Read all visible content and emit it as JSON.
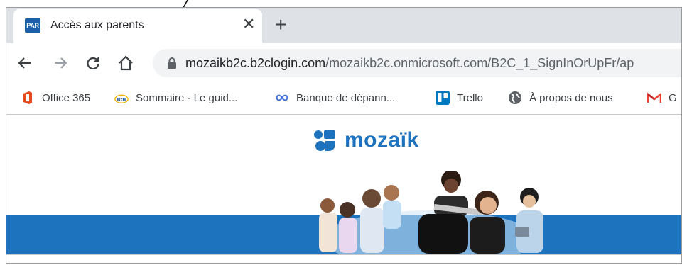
{
  "tab": {
    "favicon_text": "PAR",
    "title": "Accès aux parents",
    "close_symbol": "✕",
    "new_tab_symbol": "+"
  },
  "toolbar": {
    "url_domain": "mozaikb2c.b2clogin.com",
    "url_path": "/mozaikb2c.onmicrosoft.com/B2C_1_SignInOrUpFr/ap"
  },
  "bookmarks": [
    {
      "label": "Office 365",
      "icon": "office-icon"
    },
    {
      "label": "Sommaire - Le guid...",
      "icon": "btb-icon"
    },
    {
      "label": "Banque de dépann...",
      "icon": "infinity-icon"
    },
    {
      "label": "Trello",
      "icon": "trello-icon"
    },
    {
      "label": "À propos de nous",
      "icon": "globe-icon"
    },
    {
      "label": "G",
      "icon": "gmail-icon"
    }
  ],
  "page": {
    "logo_text": "mozaïk",
    "brand_color": "#1e73be"
  }
}
